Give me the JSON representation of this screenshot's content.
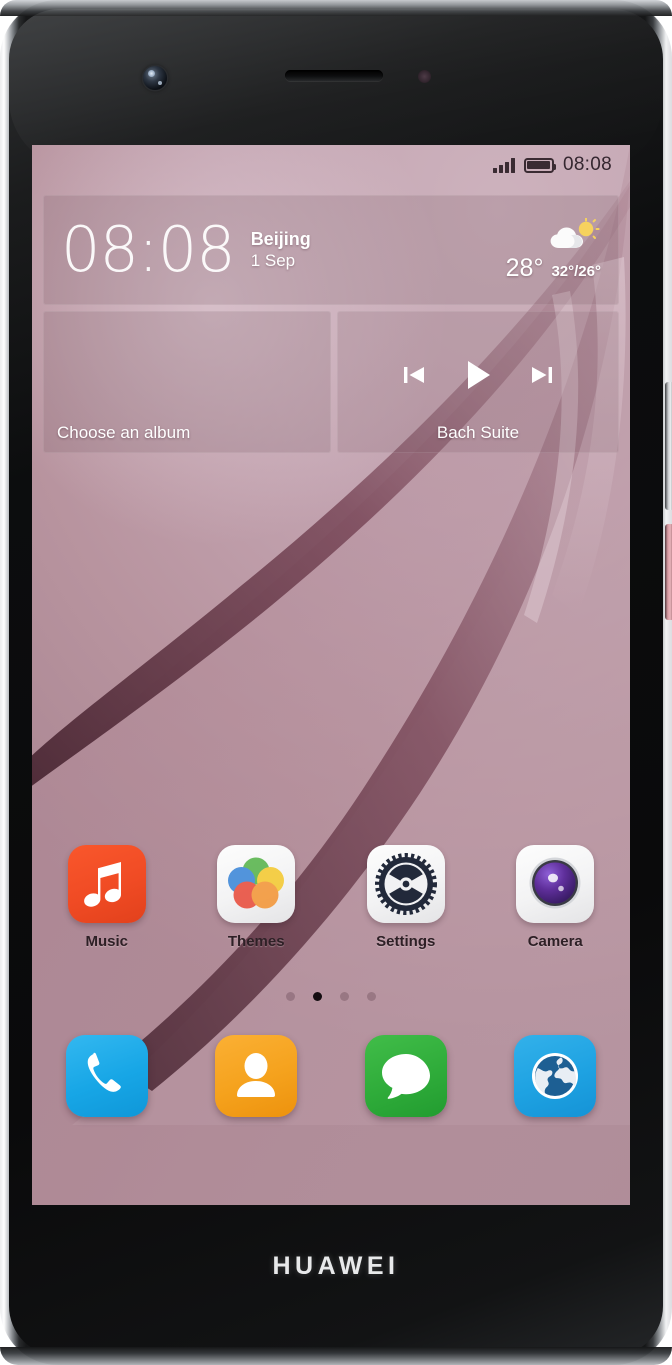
{
  "device": {
    "brand": "HUAWEI",
    "hardware": {
      "front_camera": "front-camera",
      "earpiece": "earpiece-speaker",
      "proximity_sensor": "proximity-sensor",
      "volume_button": "volume-rocker",
      "power_button": "power-button"
    }
  },
  "screen": {
    "status_bar": {
      "signal_icon": "signal-bars-icon",
      "signal_bars": 4,
      "battery_icon": "battery-icon",
      "battery_level": "full",
      "time": "08:08"
    },
    "clock_widget": {
      "time": "08:08",
      "city": "Beijing",
      "date": "1 Sep",
      "weather_icon": "partly-cloudy-icon",
      "temperature": "28°",
      "temperature_range": "32°/26°"
    },
    "album_widget": {
      "caption": "Choose an album"
    },
    "music_widget": {
      "track": "Bach Suite",
      "previous_icon": "skip-previous-icon",
      "play_icon": "play-icon",
      "next_icon": "skip-next-icon"
    },
    "apps": [
      {
        "label": "Music",
        "icon": "music-icon"
      },
      {
        "label": "Themes",
        "icon": "themes-icon"
      },
      {
        "label": "Settings",
        "icon": "settings-gear-icon"
      },
      {
        "label": "Camera",
        "icon": "camera-icon"
      }
    ],
    "page_indicator": {
      "total": 4,
      "active_index": 1
    },
    "dock": [
      {
        "name": "Phone",
        "icon": "phone-icon"
      },
      {
        "name": "Contacts",
        "icon": "contacts-icon"
      },
      {
        "name": "Messages",
        "icon": "message-bubble-icon"
      },
      {
        "name": "Browser",
        "icon": "globe-icon"
      }
    ]
  },
  "colors": {
    "wallpaper_base": "#bb99a6",
    "wallpaper_light": "#cdb2bd",
    "ribbon_dark": "#4a2330",
    "status_text": "#352730",
    "music_app": "#f04b24",
    "phone_app": "#17a6e6",
    "contacts_app": "#f5a21d",
    "messages_app": "#2fac3a",
    "browser_app": "#1ea2e2",
    "settings_gear": "#22293a",
    "camera_lens": "#5b2d91",
    "brand_text": "#e8e9ea"
  }
}
